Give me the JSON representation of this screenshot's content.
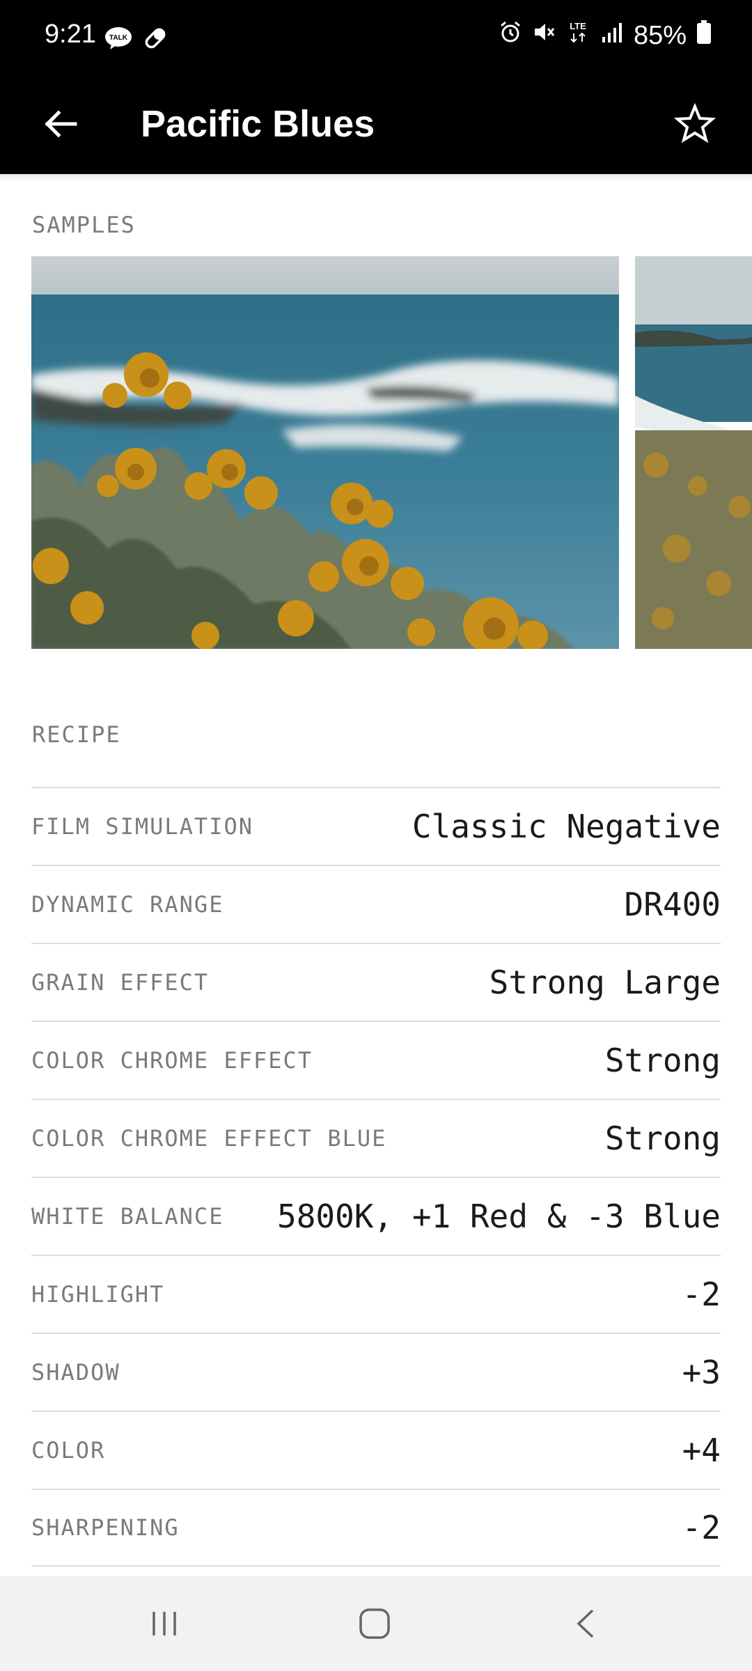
{
  "status_bar": {
    "time": "9:21",
    "battery": "85%",
    "network": "LTE"
  },
  "app_bar": {
    "title": "Pacific Blues",
    "back_icon": "arrow-left-icon",
    "favorite_icon": "star-outline-icon"
  },
  "samples": {
    "label": "SAMPLES"
  },
  "recipe": {
    "label": "RECIPE",
    "rows": [
      {
        "key": "FILM SIMULATION",
        "value": "Classic Negative"
      },
      {
        "key": "DYNAMIC RANGE",
        "value": "DR400"
      },
      {
        "key": "GRAIN EFFECT",
        "value": "Strong Large"
      },
      {
        "key": "COLOR CHROME EFFECT",
        "value": "Strong"
      },
      {
        "key": "COLOR CHROME EFFECT BLUE",
        "value": "Strong"
      },
      {
        "key": "WHITE BALANCE",
        "value": "5800K, +1 Red & -3 Blue"
      },
      {
        "key": "HIGHLIGHT",
        "value": "-2"
      },
      {
        "key": "SHADOW",
        "value": "+3"
      },
      {
        "key": "COLOR",
        "value": "+4"
      },
      {
        "key": "SHARPENING",
        "value": "-2"
      }
    ]
  },
  "colors": {
    "header_bg": "#000000",
    "label_gray": "#7a7a7a",
    "value_dark": "#1a1a1a"
  }
}
